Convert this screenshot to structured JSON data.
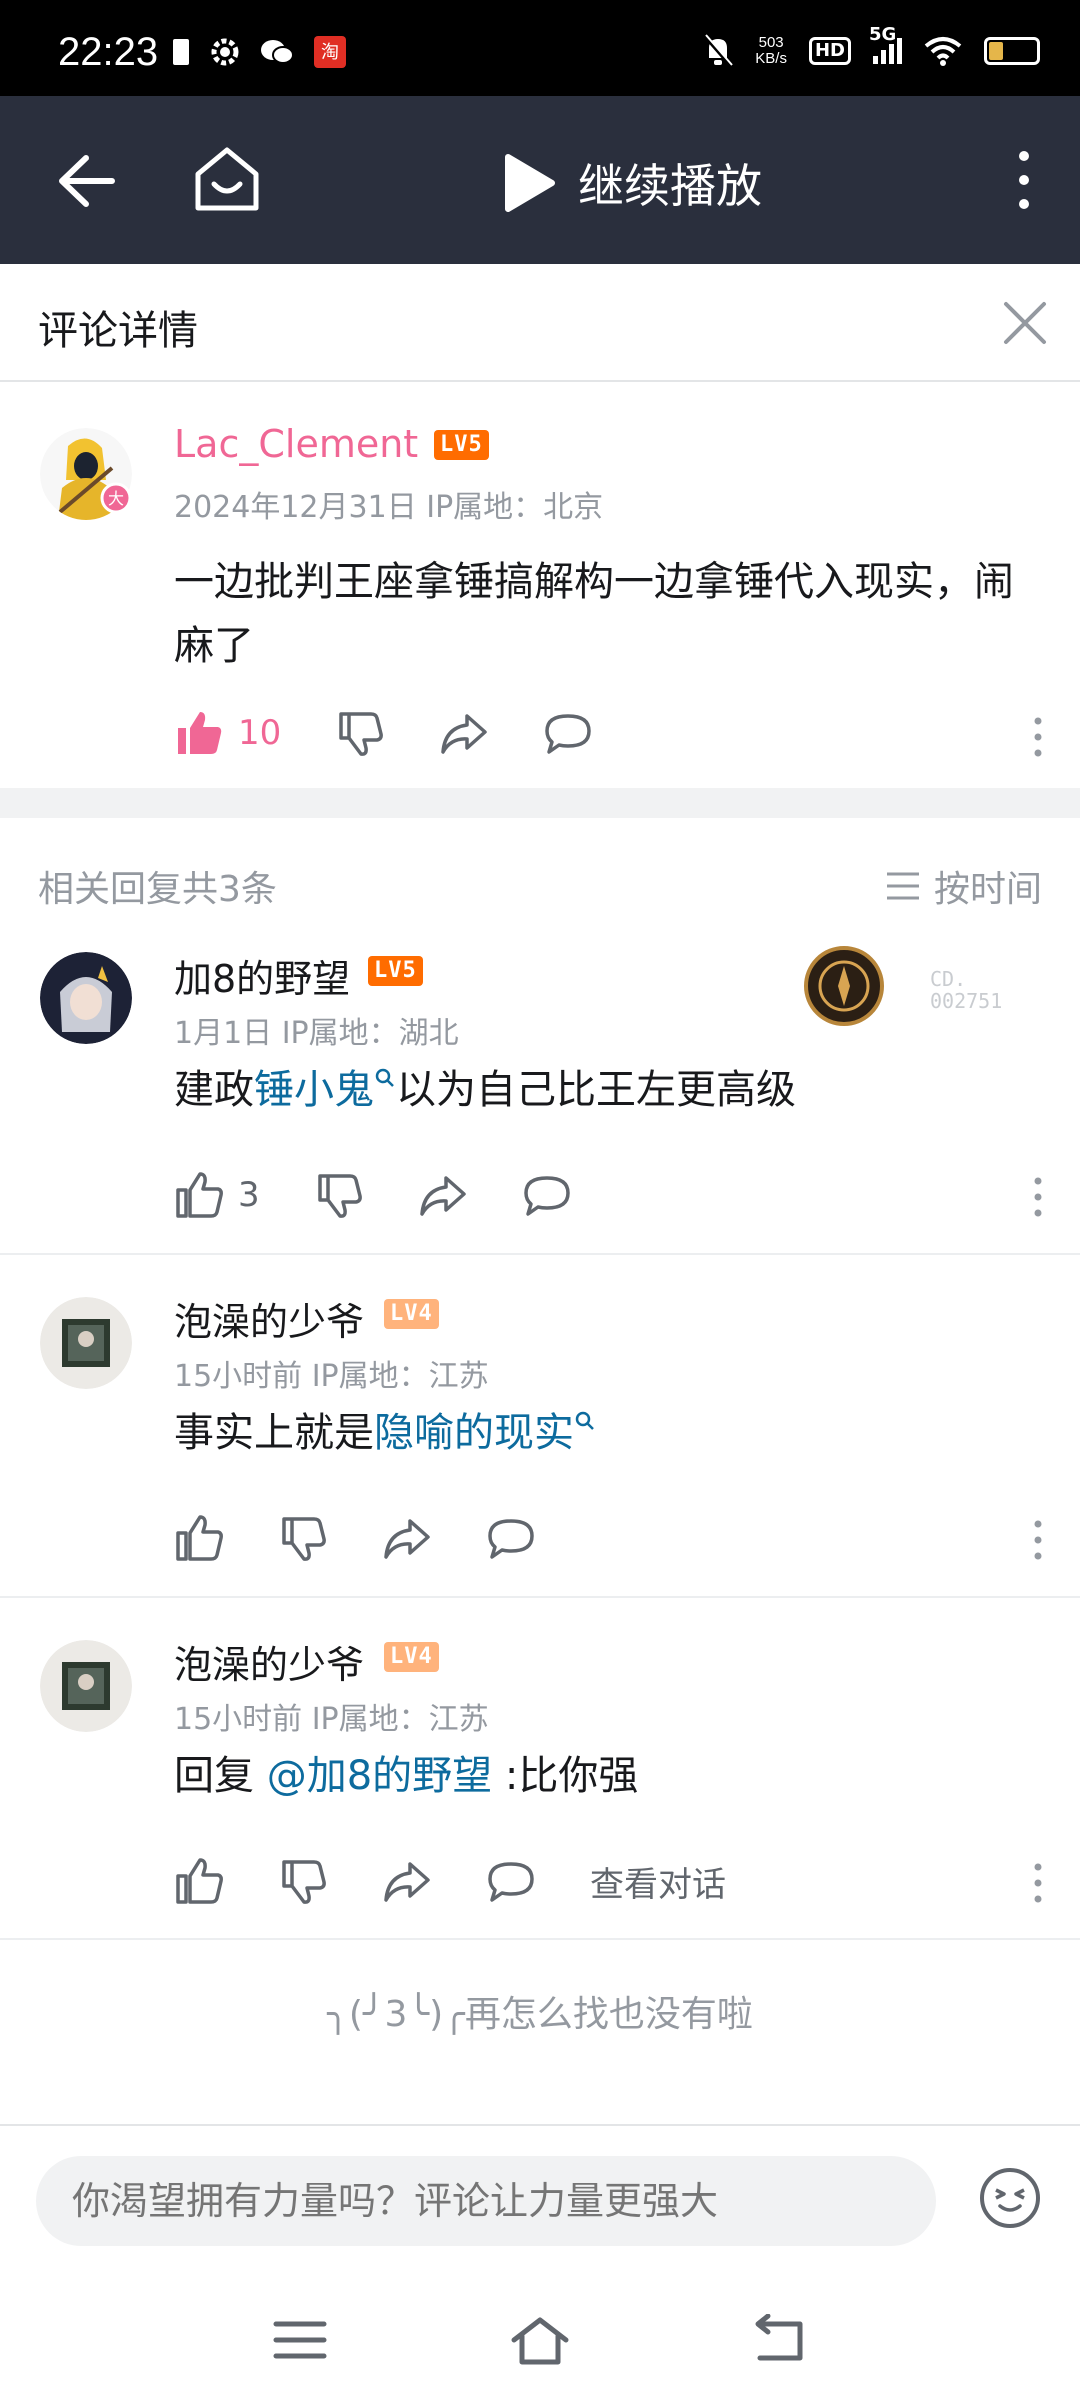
{
  "status_bar": {
    "time": "22:23",
    "net_speed_value": "503",
    "net_speed_unit": "KB/s",
    "hd_label": "HD",
    "signal_label": "5G"
  },
  "nav": {
    "play_label": "继续播放"
  },
  "detail": {
    "title": "评论详情"
  },
  "main_comment": {
    "username": "Lac_Clement",
    "level": "LV5",
    "meta": "2024年12月31日  IP属地：北京",
    "content": "一边批判王座拿锤搞解构一边拿锤代入现实，闹麻了",
    "likes": "10",
    "username_color": "#f06795",
    "level_color": "#ff6c00"
  },
  "replies_header": {
    "count_label": "相关回复共3条",
    "sort_label": "按时间"
  },
  "replies": [
    {
      "username": "加8的野望",
      "level": "LV5",
      "meta": "1月1日  IP属地：湖北",
      "content_prefix": "建政",
      "content_link": "锤小鬼",
      "content_suffix": "以为自己比王左更高级",
      "likes": "3",
      "badge_text_1": "CD.",
      "badge_text_2": "002751"
    },
    {
      "username": "泡澡的少爷",
      "level": "LV4",
      "meta": "15小时前  IP属地：江苏",
      "content_prefix": "事实上就是",
      "content_link": "隐喻的现实"
    },
    {
      "username": "泡澡的少爷",
      "level": "LV4",
      "meta": "15小时前  IP属地：江苏",
      "content_prefix": "回复 ",
      "content_link": "@加8的野望",
      "content_suffix": " :比你强",
      "view_conversation": "查看对话"
    }
  ],
  "end_text": "╮(╯3╰)╭再怎么找也没有啦",
  "input": {
    "placeholder": "你渴望拥有力量吗？评论让力量更强大"
  },
  "colors": {
    "nav_bg": "#2a2f3d",
    "link": "#0d6b9e",
    "like_active": "#f06795",
    "lv4": "#ffb37c",
    "lv5": "#ff6c00"
  }
}
